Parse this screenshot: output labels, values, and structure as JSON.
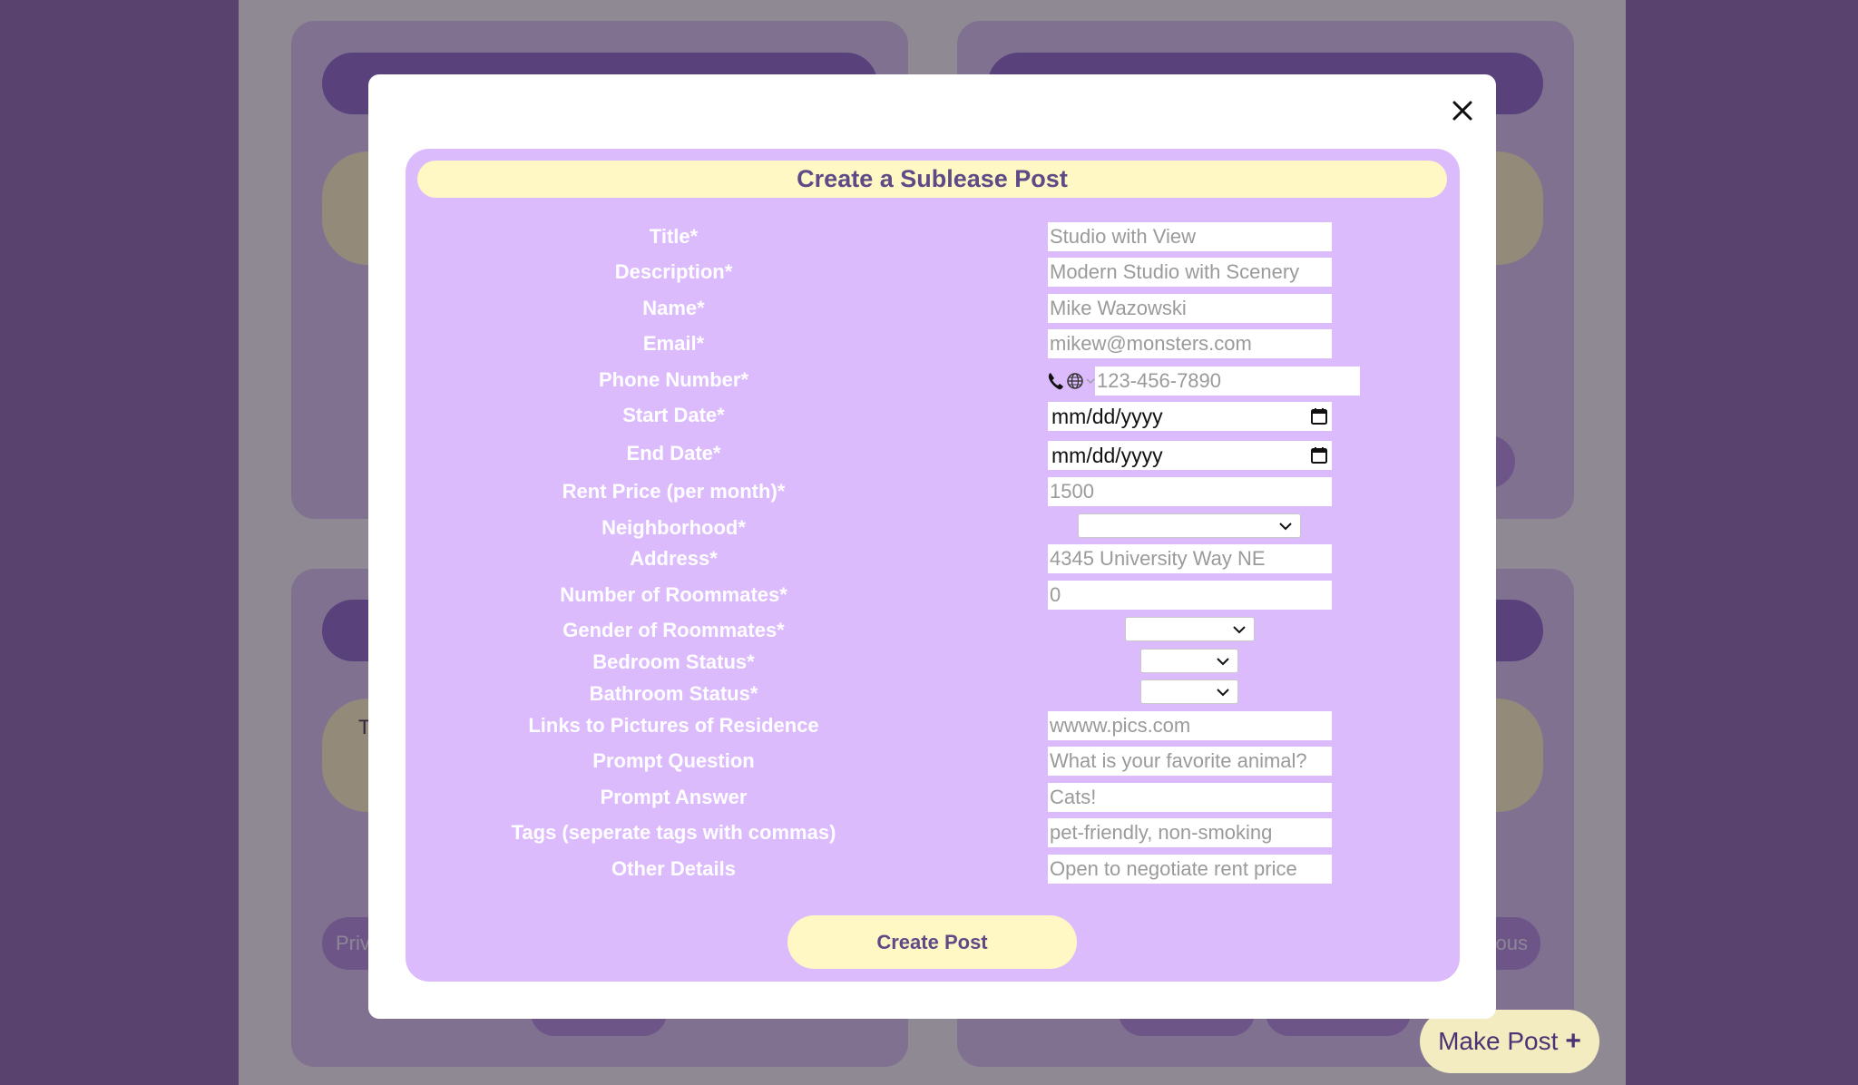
{
  "background": {
    "card_text_fragment": "T",
    "prev_button": "Priv",
    "next_button": "ous",
    "make_post": {
      "label": "Make Post",
      "icon": "plus-icon"
    }
  },
  "modal": {
    "close_icon": "close-icon",
    "title": "Create a Sublease Post",
    "fields": {
      "title": {
        "label": "Title*",
        "placeholder": "Studio with View"
      },
      "description": {
        "label": "Description*",
        "placeholder": "Modern Studio with Scenery"
      },
      "name": {
        "label": "Name*",
        "placeholder": "Mike Wazowski"
      },
      "email": {
        "label": "Email*",
        "placeholder": "mikew@monsters.com"
      },
      "phone": {
        "label": "Phone Number*",
        "placeholder": "123-456-7890",
        "country_icon": "globe-icon"
      },
      "start_date": {
        "label": "Start Date*",
        "value": "mm/dd/yyyy"
      },
      "end_date": {
        "label": "End Date*",
        "value": "mm/dd/yyyy"
      },
      "rent": {
        "label": "Rent Price (per month)*",
        "placeholder": "1500"
      },
      "neighborhood": {
        "label": "Neighborhood*",
        "value": ""
      },
      "address": {
        "label": "Address*",
        "placeholder": "4345 University Way NE"
      },
      "roommates": {
        "label": "Number of Roommates*",
        "placeholder": "0"
      },
      "gender": {
        "label": "Gender of Roommates*",
        "value": ""
      },
      "bedroom": {
        "label": "Bedroom Status*",
        "value": ""
      },
      "bathroom": {
        "label": "Bathroom Status*",
        "value": ""
      },
      "pictures": {
        "label": "Links to Pictures of Residence",
        "placeholder": "wwww.pics.com"
      },
      "prompt_question": {
        "label": "Prompt Question",
        "placeholder": "What is your favorite animal?"
      },
      "prompt_answer": {
        "label": "Prompt Answer",
        "placeholder": "Cats!"
      },
      "tags": {
        "label": "Tags (seperate tags with commas)",
        "placeholder": "pet-friendly, non-smoking"
      },
      "other": {
        "label": "Other Details",
        "placeholder": "Open to negotiate rent price"
      }
    },
    "submit_label": "Create Post"
  }
}
